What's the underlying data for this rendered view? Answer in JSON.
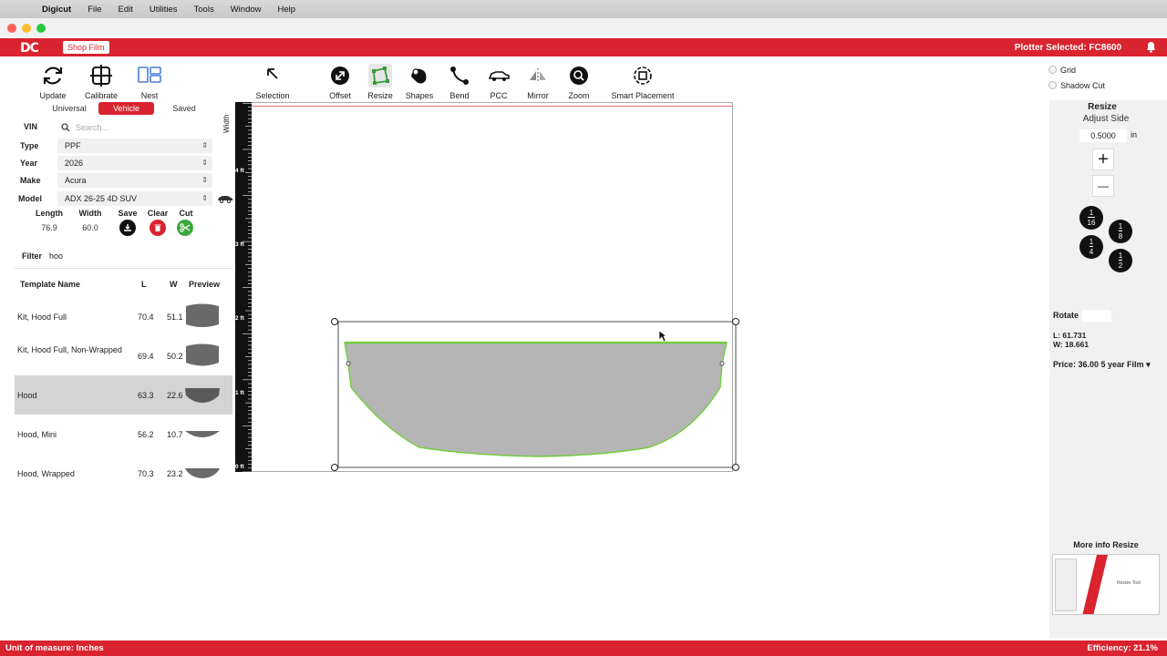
{
  "menubar": {
    "app": "Digicut",
    "items": [
      "File",
      "Edit",
      "Utilities",
      "Tools",
      "Window",
      "Help"
    ]
  },
  "header": {
    "logo": "DC",
    "shop_film": "Shop Film",
    "plotter": "Plotter Selected: FC8600"
  },
  "left_tools": {
    "update": "Update",
    "calibrate": "Calibrate",
    "nest": "Nest"
  },
  "tabs": {
    "universal": "Universal",
    "vehicle": "Vehicle",
    "saved": "Saved"
  },
  "form": {
    "vin_label": "VIN",
    "search_placeholder": "Search...",
    "type_label": "Type",
    "type_value": "PPF",
    "year_label": "Year",
    "year_value": "2026",
    "make_label": "Make",
    "make_value": "Acura",
    "model_label": "Model",
    "model_value": "ADX 26-25 4D SUV",
    "length_label": "Length",
    "length_value": "76.9",
    "width_label": "Width",
    "width_value": "60.0",
    "save_label": "Save",
    "clear_label": "Clear",
    "cut_label": "Cut",
    "filter_label": "Filter",
    "filter_value": "hoo"
  },
  "table": {
    "headers": {
      "name": "Template Name",
      "l": "L",
      "w": "W",
      "preview": "Preview"
    },
    "rows": [
      {
        "name": "Kit, Hood Full",
        "l": "70.4",
        "w": "51.1"
      },
      {
        "name": "Kit, Hood Full, Non-Wrapped",
        "l": "69.4",
        "w": "50.2"
      },
      {
        "name": "Hood",
        "l": "63.3",
        "w": "22.6"
      },
      {
        "name": "Hood, Mini",
        "l": "56.2",
        "w": "10.7"
      },
      {
        "name": "Hood, Wrapped",
        "l": "70.3",
        "w": "23.2"
      }
    ]
  },
  "toolbar": {
    "selection": "Selection",
    "offset": "Offset",
    "resize": "Resize",
    "shapes": "Shapes",
    "bend": "Bend",
    "pcc": "PCC",
    "mirror": "Mirror",
    "zoom": "Zoom",
    "smart_placement": "Smart Placement"
  },
  "ruler": {
    "label": "Width",
    "ticks": [
      "4 ft",
      "3 ft",
      "2 ft",
      "1 ft",
      "0 ft"
    ]
  },
  "right": {
    "grid": "Grid",
    "shadow_cut": "Shadow Cut",
    "title": "Resize",
    "subtitle": "Adjust Side",
    "amount": "0.5000",
    "unit": "in",
    "plus": "+",
    "minus": "—",
    "fracs": [
      {
        "n": "1",
        "d": "16"
      },
      {
        "n": "1",
        "d": "8"
      },
      {
        "n": "1",
        "d": "4"
      },
      {
        "n": "1",
        "d": "2"
      }
    ],
    "rotate": "Rotate",
    "l": "L: 61.731",
    "w": "W: 18.661",
    "price": "Price: 36.00 5 year Film",
    "more_info": "More info Resize",
    "thumb_caption": "Resize Tool"
  },
  "status": {
    "unit": "Unit of measure: Inches",
    "efficiency": "Efficiency: 21.1%"
  },
  "colors": {
    "brand": "#d9232f",
    "shape_fill": "#b5b5b5",
    "shape_stroke": "#6fcf3a"
  }
}
